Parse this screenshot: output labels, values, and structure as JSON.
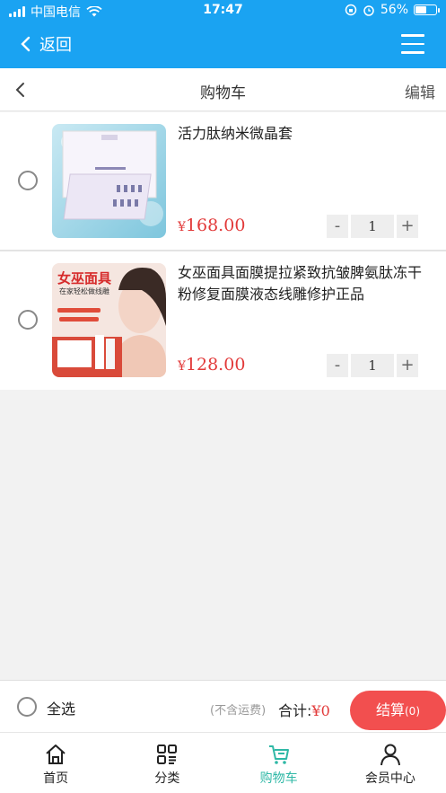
{
  "status_bar": {
    "carrier": "中国电信",
    "time": "17:47",
    "battery": "56%",
    "battery_level": 0.56
  },
  "header": {
    "back_label": "返回",
    "menu_icon": "hamburger-icon"
  },
  "cart_title": {
    "title": "购物车",
    "edit_label": "编辑"
  },
  "items": [
    {
      "name": "活力肽纳米微晶套",
      "currency": "¥",
      "price": "168.00",
      "qty_minus": "-",
      "quantity": "1",
      "qty_plus": "+"
    },
    {
      "name": "女巫面具面膜提拉紧致抗皱脾氨肽冻干粉修复面膜液态线雕修护正品",
      "currency": "¥",
      "price": "128.00",
      "qty_minus": "-",
      "quantity": "1",
      "qty_plus": "+",
      "image_text": {
        "title": "女巫面具",
        "subtitle": "在家轻松做线雕"
      }
    }
  ],
  "checkout": {
    "select_all": "全选",
    "shipping_note": "(不含运费)",
    "total_label": "合计:",
    "total_amount": "¥0",
    "settle_label": "结算",
    "settle_count": "(0)"
  },
  "tabs": [
    {
      "label": "首页",
      "icon": "home-icon"
    },
    {
      "label": "分类",
      "icon": "category-icon"
    },
    {
      "label": "购物车",
      "icon": "cart-icon",
      "active": true
    },
    {
      "label": "会员中心",
      "icon": "user-icon"
    }
  ],
  "colors": {
    "header_blue": "#1aa3f2",
    "price_red": "#e23a3a",
    "settle_red": "#f24f4f",
    "active_tab": "#2fb8a6"
  }
}
